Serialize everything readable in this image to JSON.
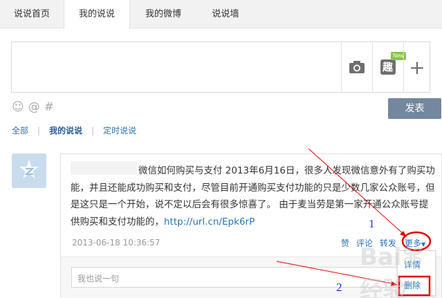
{
  "tabs": [
    {
      "label": "说说首页",
      "active": false
    },
    {
      "label": "我的说说",
      "active": true
    },
    {
      "label": "我的微博",
      "active": false
    },
    {
      "label": "说说墙",
      "active": false
    }
  ],
  "composer": {
    "placeholder": "",
    "tools": {
      "camera_icon": "camera-icon",
      "qu_label": "趣",
      "qu_badge": "New",
      "plus_label": "+"
    },
    "emotes": [
      "☺",
      "@",
      "#"
    ],
    "publish_label": "发表"
  },
  "filter": {
    "all": "全部",
    "mine": "我的说说",
    "scheduled": "定时说说",
    "separator": "|"
  },
  "post": {
    "text_prefix": "微信如何购买与支付 2013年6月16日，很多人发现微信意外有了购买功能，并且还能成功购买和支付，尽管目前开通购买支付功能的只是少数几家公众账号，但是这只是一个开始，说不定以后会有很多惊喜了。 由于麦当劳是第一家开通公众账号提供购买和支付功能的，",
    "link": "http://url.cn/Epk6rP",
    "time": "2013-06-18 10:36:57",
    "actions": {
      "like": "赞",
      "comment": "评论",
      "forward": "转发",
      "more": "更多"
    },
    "reply_placeholder": "我也说一句"
  },
  "menu": {
    "details": "详情",
    "delete": "删除"
  },
  "annotations": {
    "n1": "1",
    "n2": "2",
    "watermark": "Bai⌘经验",
    "color": "#e00000"
  }
}
